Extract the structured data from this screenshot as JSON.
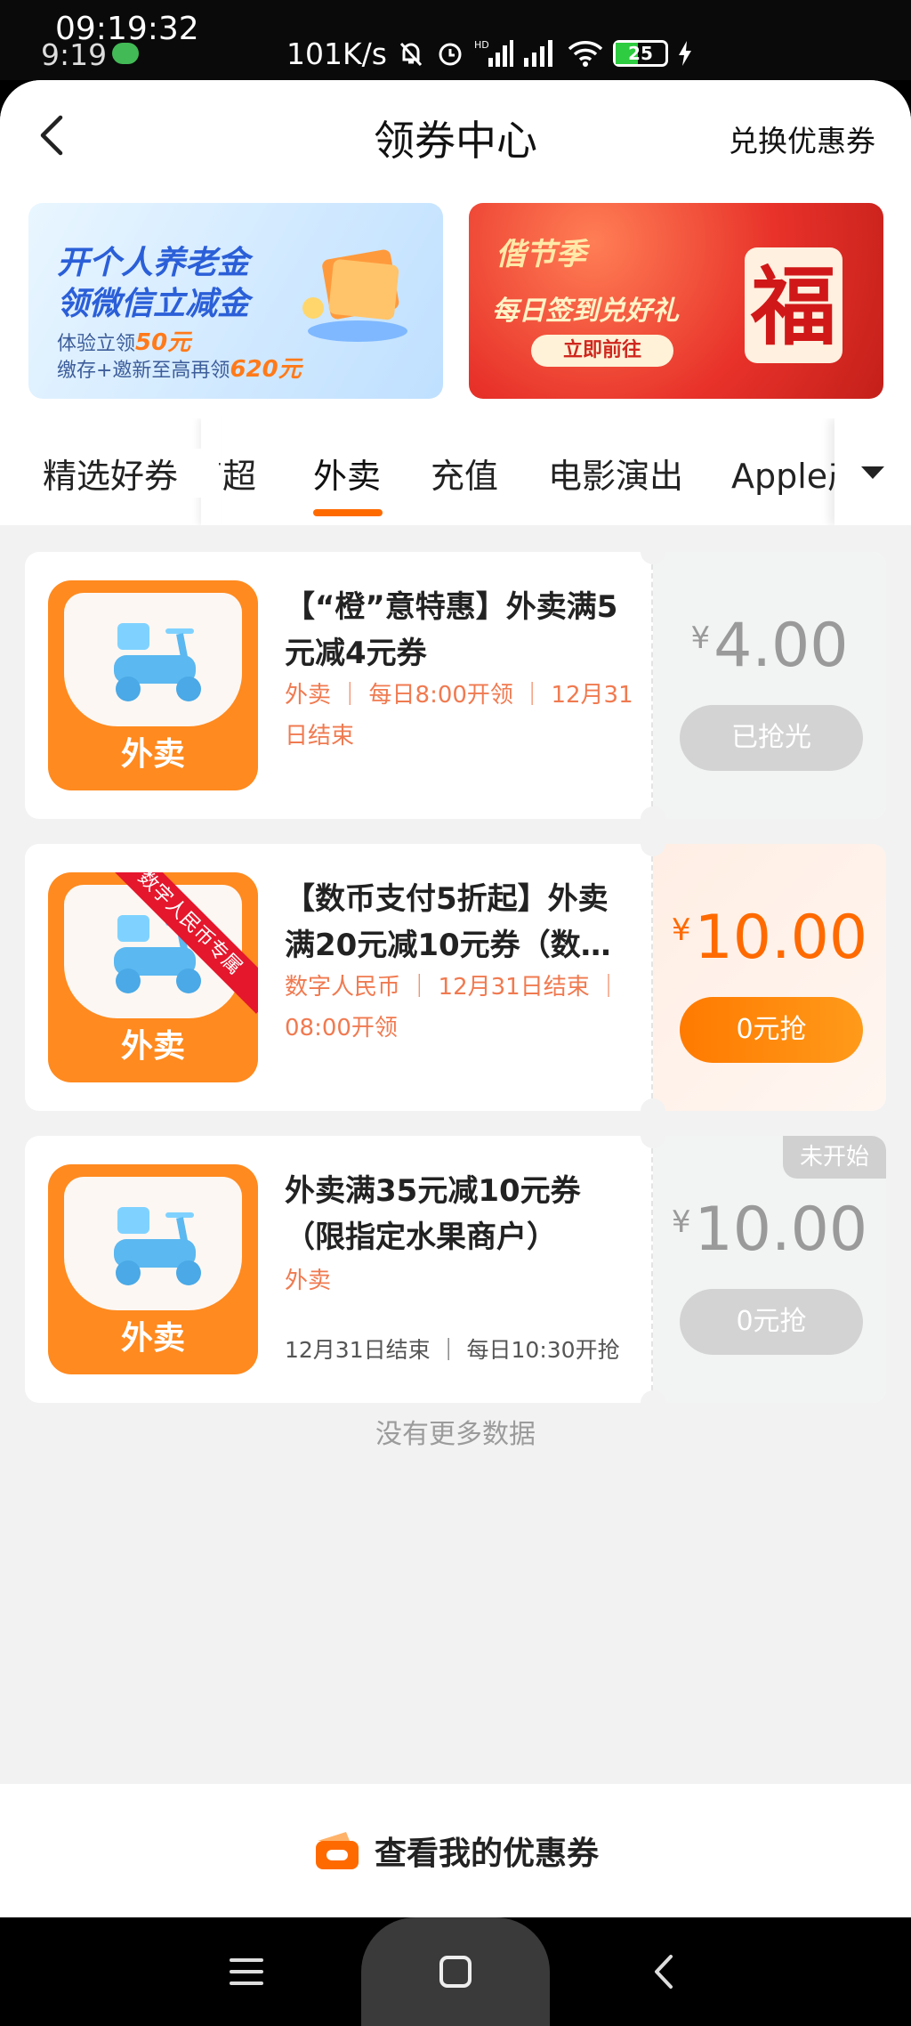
{
  "status_bar": {
    "time_large": "09:19:32",
    "time_small": "9:19",
    "net_speed": "101K/s",
    "signal_label": "HD",
    "battery": "25"
  },
  "header": {
    "title": "领券中心",
    "right_action": "兑换优惠券"
  },
  "banners": [
    {
      "line1": "开个人养老金",
      "line2": "领微信立减金",
      "line3_prefix": "体验立领",
      "line3_amount": "50元",
      "line4_prefix": "缴存+邀新至高再领",
      "line4_amount": "620元"
    },
    {
      "logo": "偕节季",
      "line1": "每日签到兑好礼",
      "button": "立即前往",
      "art_char": "福"
    }
  ],
  "tabs": [
    "精选好券",
    "商超",
    "外卖",
    "充值",
    "电影演出",
    "Apple产"
  ],
  "active_tab_index": 2,
  "coupons": [
    {
      "thumb_label": "外卖",
      "title": "【“橙”意特惠】外卖满5元减4元券",
      "meta_line1": "外卖 ｜ 每日8:00开领 ｜ 12月31",
      "meta_line2": "日结束",
      "currency": "¥",
      "amount": "4.00",
      "button": "已抢光",
      "state": "sold_out"
    },
    {
      "thumb_label": "外卖",
      "ribbon": "数字人民币专属",
      "title_line1": "【数币支付5折起】外卖",
      "title_line2": "满20元减10元券（数…",
      "meta_line1": "数字人民币 ｜ 12月31日结束 ｜",
      "meta_line2": "08:00开领",
      "currency": "¥",
      "amount": "10.00",
      "button": "0元抢",
      "state": "available"
    },
    {
      "thumb_label": "外卖",
      "badge": "未开始",
      "title_line1": "外卖满35元减10元券",
      "title_line2": "（限指定水果商户）",
      "meta_line1": "外卖",
      "meta_line2": "12月31日结束 ｜ 每日10:30开抢",
      "currency": "¥",
      "amount": "10.00",
      "button": "0元抢",
      "state": "not_started"
    }
  ],
  "no_more": "没有更多数据",
  "footer": {
    "label": "查看我的优惠券"
  },
  "colors": {
    "accent": "#ff6a00",
    "meta_text": "#f07a50",
    "disabled": "#d3d3d3"
  }
}
